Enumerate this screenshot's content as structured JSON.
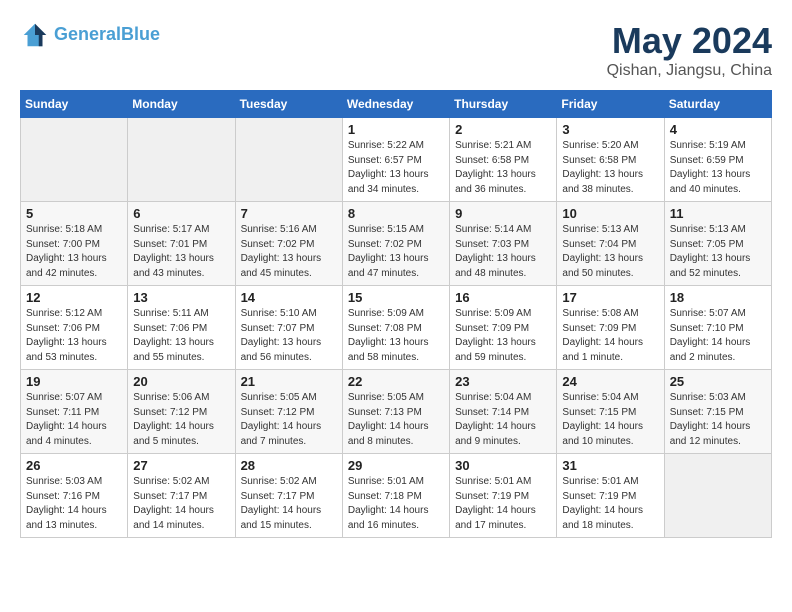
{
  "header": {
    "logo_line1": "General",
    "logo_line2": "Blue",
    "month": "May 2024",
    "location": "Qishan, Jiangsu, China"
  },
  "weekdays": [
    "Sunday",
    "Monday",
    "Tuesday",
    "Wednesday",
    "Thursday",
    "Friday",
    "Saturday"
  ],
  "weeks": [
    [
      {
        "day": "",
        "info": ""
      },
      {
        "day": "",
        "info": ""
      },
      {
        "day": "",
        "info": ""
      },
      {
        "day": "1",
        "info": "Sunrise: 5:22 AM\nSunset: 6:57 PM\nDaylight: 13 hours\nand 34 minutes."
      },
      {
        "day": "2",
        "info": "Sunrise: 5:21 AM\nSunset: 6:58 PM\nDaylight: 13 hours\nand 36 minutes."
      },
      {
        "day": "3",
        "info": "Sunrise: 5:20 AM\nSunset: 6:58 PM\nDaylight: 13 hours\nand 38 minutes."
      },
      {
        "day": "4",
        "info": "Sunrise: 5:19 AM\nSunset: 6:59 PM\nDaylight: 13 hours\nand 40 minutes."
      }
    ],
    [
      {
        "day": "5",
        "info": "Sunrise: 5:18 AM\nSunset: 7:00 PM\nDaylight: 13 hours\nand 42 minutes."
      },
      {
        "day": "6",
        "info": "Sunrise: 5:17 AM\nSunset: 7:01 PM\nDaylight: 13 hours\nand 43 minutes."
      },
      {
        "day": "7",
        "info": "Sunrise: 5:16 AM\nSunset: 7:02 PM\nDaylight: 13 hours\nand 45 minutes."
      },
      {
        "day": "8",
        "info": "Sunrise: 5:15 AM\nSunset: 7:02 PM\nDaylight: 13 hours\nand 47 minutes."
      },
      {
        "day": "9",
        "info": "Sunrise: 5:14 AM\nSunset: 7:03 PM\nDaylight: 13 hours\nand 48 minutes."
      },
      {
        "day": "10",
        "info": "Sunrise: 5:13 AM\nSunset: 7:04 PM\nDaylight: 13 hours\nand 50 minutes."
      },
      {
        "day": "11",
        "info": "Sunrise: 5:13 AM\nSunset: 7:05 PM\nDaylight: 13 hours\nand 52 minutes."
      }
    ],
    [
      {
        "day": "12",
        "info": "Sunrise: 5:12 AM\nSunset: 7:06 PM\nDaylight: 13 hours\nand 53 minutes."
      },
      {
        "day": "13",
        "info": "Sunrise: 5:11 AM\nSunset: 7:06 PM\nDaylight: 13 hours\nand 55 minutes."
      },
      {
        "day": "14",
        "info": "Sunrise: 5:10 AM\nSunset: 7:07 PM\nDaylight: 13 hours\nand 56 minutes."
      },
      {
        "day": "15",
        "info": "Sunrise: 5:09 AM\nSunset: 7:08 PM\nDaylight: 13 hours\nand 58 minutes."
      },
      {
        "day": "16",
        "info": "Sunrise: 5:09 AM\nSunset: 7:09 PM\nDaylight: 13 hours\nand 59 minutes."
      },
      {
        "day": "17",
        "info": "Sunrise: 5:08 AM\nSunset: 7:09 PM\nDaylight: 14 hours\nand 1 minute."
      },
      {
        "day": "18",
        "info": "Sunrise: 5:07 AM\nSunset: 7:10 PM\nDaylight: 14 hours\nand 2 minutes."
      }
    ],
    [
      {
        "day": "19",
        "info": "Sunrise: 5:07 AM\nSunset: 7:11 PM\nDaylight: 14 hours\nand 4 minutes."
      },
      {
        "day": "20",
        "info": "Sunrise: 5:06 AM\nSunset: 7:12 PM\nDaylight: 14 hours\nand 5 minutes."
      },
      {
        "day": "21",
        "info": "Sunrise: 5:05 AM\nSunset: 7:12 PM\nDaylight: 14 hours\nand 7 minutes."
      },
      {
        "day": "22",
        "info": "Sunrise: 5:05 AM\nSunset: 7:13 PM\nDaylight: 14 hours\nand 8 minutes."
      },
      {
        "day": "23",
        "info": "Sunrise: 5:04 AM\nSunset: 7:14 PM\nDaylight: 14 hours\nand 9 minutes."
      },
      {
        "day": "24",
        "info": "Sunrise: 5:04 AM\nSunset: 7:15 PM\nDaylight: 14 hours\nand 10 minutes."
      },
      {
        "day": "25",
        "info": "Sunrise: 5:03 AM\nSunset: 7:15 PM\nDaylight: 14 hours\nand 12 minutes."
      }
    ],
    [
      {
        "day": "26",
        "info": "Sunrise: 5:03 AM\nSunset: 7:16 PM\nDaylight: 14 hours\nand 13 minutes."
      },
      {
        "day": "27",
        "info": "Sunrise: 5:02 AM\nSunset: 7:17 PM\nDaylight: 14 hours\nand 14 minutes."
      },
      {
        "day": "28",
        "info": "Sunrise: 5:02 AM\nSunset: 7:17 PM\nDaylight: 14 hours\nand 15 minutes."
      },
      {
        "day": "29",
        "info": "Sunrise: 5:01 AM\nSunset: 7:18 PM\nDaylight: 14 hours\nand 16 minutes."
      },
      {
        "day": "30",
        "info": "Sunrise: 5:01 AM\nSunset: 7:19 PM\nDaylight: 14 hours\nand 17 minutes."
      },
      {
        "day": "31",
        "info": "Sunrise: 5:01 AM\nSunset: 7:19 PM\nDaylight: 14 hours\nand 18 minutes."
      },
      {
        "day": "",
        "info": ""
      }
    ]
  ]
}
